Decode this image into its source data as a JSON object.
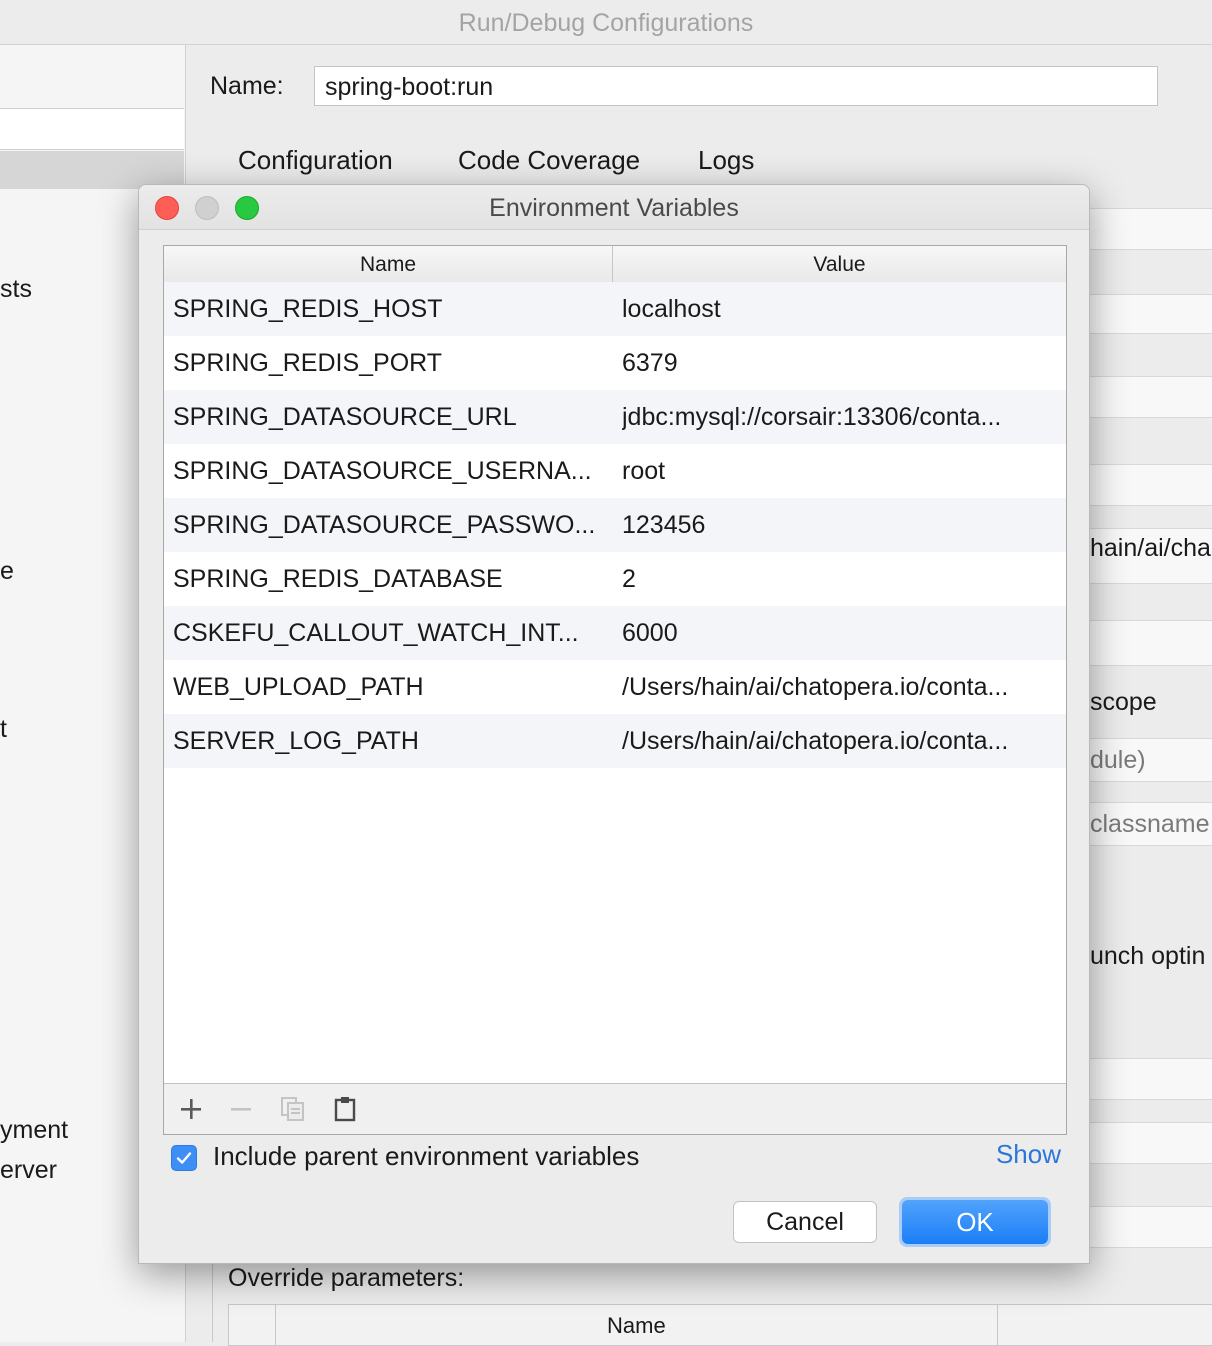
{
  "window": {
    "title": "Run/Debug Configurations"
  },
  "config": {
    "name_label": "Name:",
    "name_value": "spring-boot:run",
    "tabs": [
      "Configuration",
      "Code Coverage",
      "Logs"
    ]
  },
  "left_fragments": [
    "sts",
    "e",
    "t",
    "yment",
    "erver"
  ],
  "right_fragments": [
    "hain/ai/cha",
    "scope",
    "dule)",
    "classname",
    "unch optin"
  ],
  "override": {
    "label": "Override parameters:",
    "name_header": "Name"
  },
  "dialog": {
    "title": "Environment Variables",
    "columns": {
      "name": "Name",
      "value": "Value"
    },
    "rows": [
      {
        "name": "SPRING_REDIS_HOST",
        "value": "localhost"
      },
      {
        "name": "SPRING_REDIS_PORT",
        "value": "6379"
      },
      {
        "name": "SPRING_DATASOURCE_URL",
        "value": "jdbc:mysql://corsair:13306/conta..."
      },
      {
        "name": "SPRING_DATASOURCE_USERNA...",
        "value": "root"
      },
      {
        "name": "SPRING_DATASOURCE_PASSWO...",
        "value": "123456"
      },
      {
        "name": "SPRING_REDIS_DATABASE",
        "value": "2"
      },
      {
        "name": "CSKEFU_CALLOUT_WATCH_INT...",
        "value": "6000"
      },
      {
        "name": "WEB_UPLOAD_PATH",
        "value": "/Users/hain/ai/chatopera.io/conta..."
      },
      {
        "name": "SERVER_LOG_PATH",
        "value": "/Users/hain/ai/chatopera.io/conta..."
      }
    ],
    "toolbar_icons": [
      "plus-icon",
      "minus-icon",
      "copy-icon",
      "clipboard-icon"
    ],
    "include_parent_label": "Include parent environment variables",
    "include_parent_checked": true,
    "show_link": "Show",
    "cancel_label": "Cancel",
    "ok_label": "OK"
  },
  "colors": {
    "accent": "#1a7ef6",
    "link": "#2b77d9",
    "row_alt": "#f3f5f9"
  }
}
